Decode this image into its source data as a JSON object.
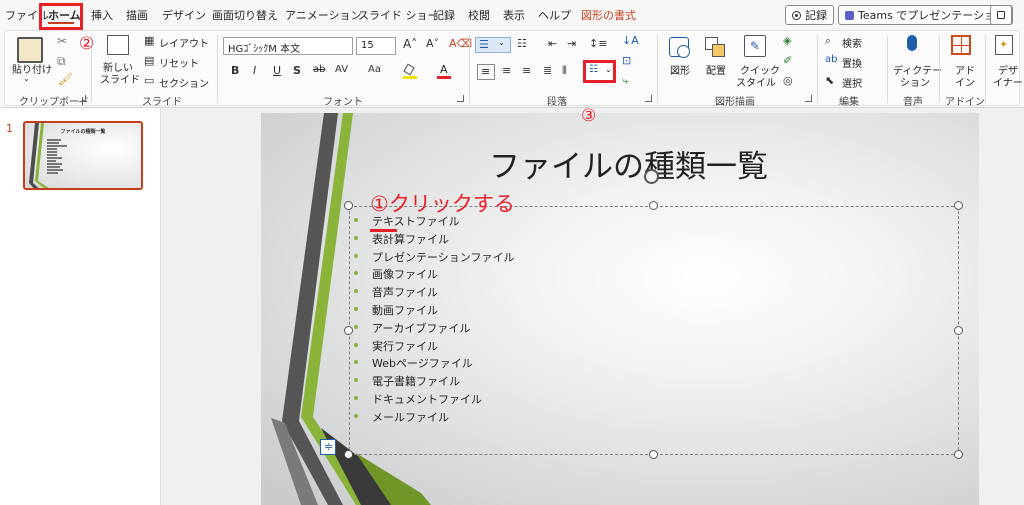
{
  "tabs": [
    {
      "label": "ファイル",
      "active": false
    },
    {
      "label": "ホーム",
      "active": true
    },
    {
      "label": "挿入",
      "active": false
    },
    {
      "label": "描画",
      "active": false
    },
    {
      "label": "デザイン",
      "active": false
    },
    {
      "label": "画面切り替え",
      "active": false
    },
    {
      "label": "アニメーション",
      "active": false
    },
    {
      "label": "スライド ショー",
      "active": false
    },
    {
      "label": "記録",
      "active": false
    },
    {
      "label": "校閲",
      "active": false
    },
    {
      "label": "表示",
      "active": false
    },
    {
      "label": "ヘルプ",
      "active": false
    },
    {
      "label": "図形の書式",
      "active": false,
      "contextual": true
    }
  ],
  "topbar": {
    "record_label": "記録",
    "teams_label": "Teams でプレゼンテーション"
  },
  "ribbon": {
    "clipboard": {
      "paste_label": "貼り付け",
      "group_label": "クリップボード"
    },
    "slides": {
      "new_slide_label": "新しい\nスライド",
      "new_slide_line1": "新しい",
      "new_slide_line2": "スライド",
      "layout_label": "レイアウト",
      "reset_label": "リセット",
      "section_label": "セクション",
      "group_label": "スライド"
    },
    "font": {
      "font_name": "HGｺﾞｼｯｸM 本文",
      "font_size": "15",
      "bold": "B",
      "italic": "I",
      "underline": "U",
      "shadow": "S",
      "strike": "ab",
      "spacing": "AV",
      "case": "Aa",
      "group_label": "フォント"
    },
    "paragraph": {
      "group_label": "段落"
    },
    "drawing": {
      "shapes_label": "図形",
      "arrange_label": "配置",
      "quickstyle_line1": "クイック",
      "quickstyle_line2": "スタイル",
      "group_label": "図形描画"
    },
    "editing": {
      "find_label": "検索",
      "replace_label": "置換",
      "select_label": "選択",
      "group_label": "編集"
    },
    "voice": {
      "dictate_line1": "ディクテー",
      "dictate_line2": "ション",
      "group_label": "音声"
    },
    "addins": {
      "addin_line1": "アド",
      "addin_line2": "イン",
      "group_label": "アドイン"
    },
    "designer": {
      "line1": "デザ",
      "line2": "イナー"
    }
  },
  "thumbnail": {
    "number": "1",
    "title": "ファイルの種類一覧"
  },
  "slide": {
    "title": "ファイルの種類一覧",
    "bullets": [
      "テキストファイル",
      "表計算ファイル",
      "プレゼンテーションファイル",
      "画像ファイル",
      "音声ファイル",
      "動画ファイル",
      "アーカイブファイル",
      "実行ファイル",
      "Webページファイル",
      "電子書籍ファイル",
      "ドキュメントファイル",
      "メールファイル"
    ]
  },
  "annotations": {
    "step1": "①クリックする",
    "step2": "②",
    "step3": "③"
  },
  "colors": {
    "annotation_red": "#e8202a",
    "accent_orange": "#c43e1c",
    "bullet_green": "#8ab33a",
    "stripe_dark": "#4d4d4d",
    "stripe_green": "#8ab33a"
  }
}
